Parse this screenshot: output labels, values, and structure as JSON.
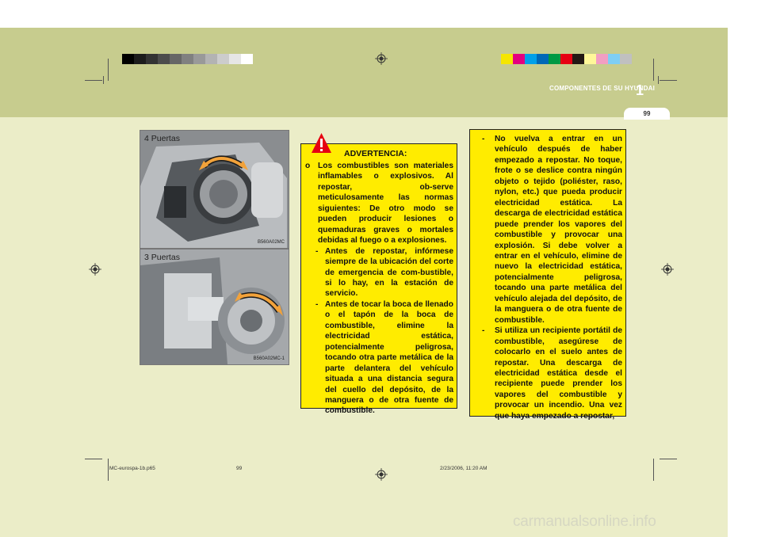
{
  "header": {
    "section_title": "COMPONENTES DE SU HYUNDAI",
    "chapter_number": "1",
    "page_number": "99"
  },
  "colors": {
    "header_band": "#c7cc8e",
    "page_bg": "#ebedc8",
    "warning_yellow": "#ffec00",
    "grayscale_bar": [
      "#000000",
      "#1c1c1c",
      "#333333",
      "#4c4c4c",
      "#666666",
      "#808080",
      "#999999",
      "#b3b3b3",
      "#cccccc",
      "#e6e6e6",
      "#ffffff"
    ],
    "color_bar": [
      "#f5e600",
      "#e4007f",
      "#00a0e9",
      "#0068b7",
      "#009944",
      "#e60012",
      "#231815",
      "#fff799",
      "#f19ec2",
      "#7ecef4",
      "#c0c0c0"
    ]
  },
  "figures": [
    {
      "label": "4 Puertas",
      "code": "B560A02MC"
    },
    {
      "label": "3 Puertas",
      "code": "B560A02MC-1"
    }
  ],
  "warning": {
    "icon": "exclamation-warning-icon",
    "title": "ADVERTENCIA:",
    "intro_marker": "o",
    "intro": "Los combustibles son materiales inflamables o explosivos. Al repostar, ob-serve meticulosamente las normas siguientes: De otro modo se pueden producir lesiones o quemaduras graves o mortales debidas al fuego o a explosiones.",
    "items": [
      {
        "marker": "-",
        "text": "Antes de repostar, infórmese siempre de la ubicación del corte de emergencia de com-bustible, si lo hay, en la estación de servicio."
      },
      {
        "marker": "-",
        "text": "Antes de tocar la boca de llenado o el tapón de la boca de combustible, elimine la electricidad estática, potencialmente peligrosa, tocando otra parte metálica de la parte delantera del vehículo situada a una distancia segura del cuello del depósito, de la manguera o de otra fuente de combustible."
      }
    ]
  },
  "warning_cont": {
    "items": [
      {
        "marker": "-",
        "text": "No vuelva a entrar en un vehículo después de haber empezado a repostar. No toque, frote o se deslice contra ningún objeto o tejido (poliéster, raso, nylon, etc.) que pueda producir electricidad estática. La descarga de electricidad estática puede prender los vapores del combustible y provocar una explosión. Si debe volver a entrar en el vehículo, elimine de nuevo la electricidad estática, potencialmente peligrosa, tocando una parte metálica del vehículo alejada del depósito, de la manguera o de otra fuente de combustible."
      },
      {
        "marker": "-",
        "text": "Si utiliza un recipiente portátil de combustible, asegúrese de colocarlo en el suelo antes de repostar. Una descarga de electricidad estática desde el recipiente puede prender los vapores del combustible y provocar un incendio. Una vez que haya empezado a repostar,"
      }
    ]
  },
  "footer": {
    "file": "MC-eurospa-1b.p65",
    "page": "99",
    "datetime": "2/23/2006, 11:20 AM"
  },
  "watermark": "carmanualsonline.info"
}
